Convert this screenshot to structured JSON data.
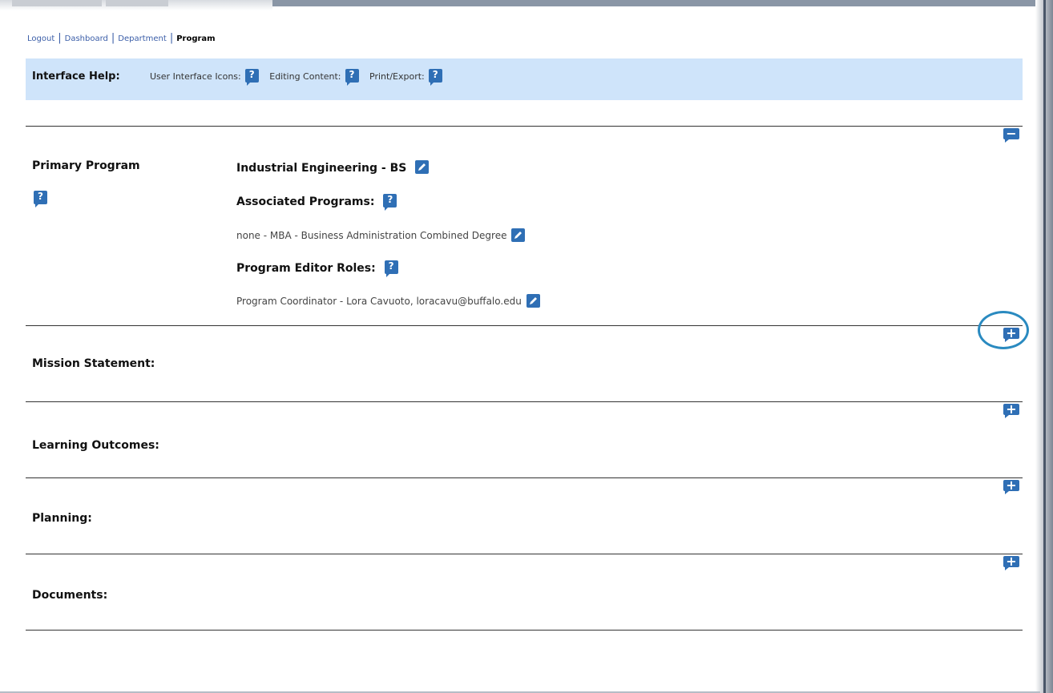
{
  "breadcrumb": {
    "logout": "Logout",
    "dashboard": "Dashboard",
    "department": "Department",
    "current": "Program",
    "separator": "|"
  },
  "help_bar": {
    "title": "Interface Help:",
    "items": [
      {
        "label": "User Interface Icons:",
        "icon": "help-icon"
      },
      {
        "label": "Editing Content:",
        "icon": "help-icon"
      },
      {
        "label": "Print/Export:",
        "icon": "help-icon"
      }
    ]
  },
  "primary_program": {
    "label": "Primary Program",
    "program_name": "Industrial Engineering - BS",
    "associated_label": "Associated Programs:",
    "associated_value": "none - MBA - Business Administration Combined Degree",
    "editor_roles_label": "Program Editor Roles:",
    "editor_roles_value": "Program Coordinator - Lora Cavuoto, loracavu@buffalo.edu",
    "toggle_symbol": "−"
  },
  "sections": [
    {
      "label": "Mission Statement:",
      "toggle_symbol": "+"
    },
    {
      "label": "Learning Outcomes:",
      "toggle_symbol": "+"
    },
    {
      "label": "Planning:",
      "toggle_symbol": "+"
    },
    {
      "label": "Documents:",
      "toggle_symbol": "+"
    }
  ],
  "colors": {
    "icon_blue": "#2f6fb5",
    "help_bar_bg": "#cfe4fa",
    "link_blue": "#3b5ea8",
    "highlight_ring": "#2a8ac0"
  },
  "icons": {
    "help": "question-mark",
    "edit": "pencil",
    "collapse": "minus-speech-bubble",
    "expand": "plus-speech-bubble"
  }
}
